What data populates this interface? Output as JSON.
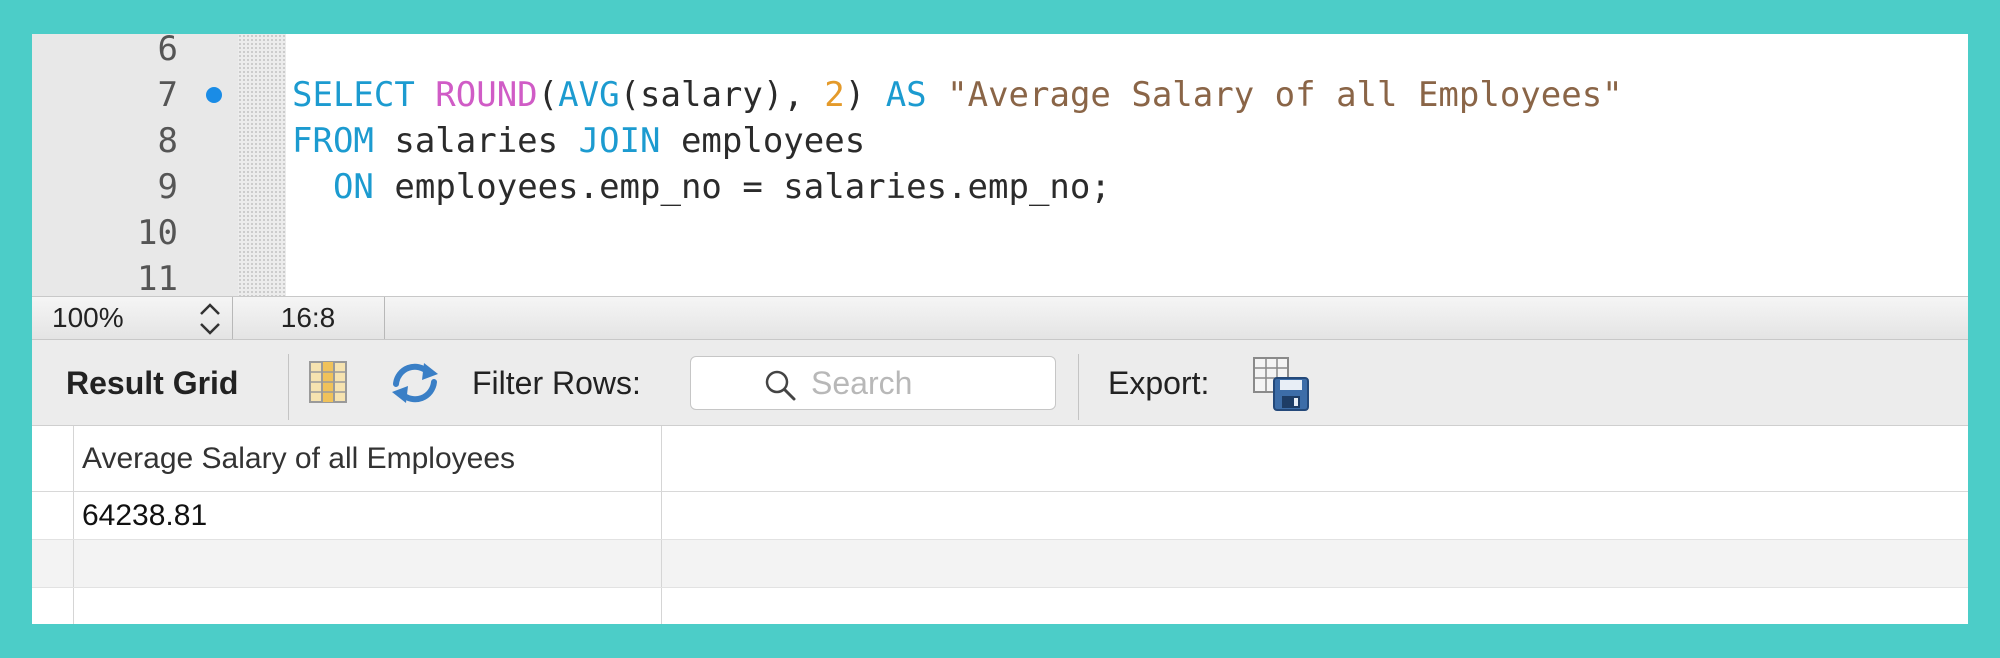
{
  "editor": {
    "lines": [
      {
        "number": "6",
        "breakpoint": false,
        "tokens": []
      },
      {
        "number": "7",
        "breakpoint": true,
        "tokens": [
          {
            "text": "SELECT ",
            "kind": "keyword"
          },
          {
            "text": "ROUND",
            "kind": "func"
          },
          {
            "text": "(",
            "kind": "plain"
          },
          {
            "text": "AVG",
            "kind": "keyword"
          },
          {
            "text": "(salary), ",
            "kind": "plain"
          },
          {
            "text": "2",
            "kind": "number"
          },
          {
            "text": ") ",
            "kind": "plain"
          },
          {
            "text": "AS",
            "kind": "keyword"
          },
          {
            "text": " ",
            "kind": "plain"
          },
          {
            "text": "\"Average Salary of all Employees\"",
            "kind": "string"
          }
        ]
      },
      {
        "number": "8",
        "breakpoint": false,
        "tokens": [
          {
            "text": "FROM",
            "kind": "keyword"
          },
          {
            "text": " salaries ",
            "kind": "plain"
          },
          {
            "text": "JOIN",
            "kind": "keyword"
          },
          {
            "text": " employees",
            "kind": "plain"
          }
        ]
      },
      {
        "number": "9",
        "breakpoint": false,
        "tokens": [
          {
            "text": "  ",
            "kind": "plain"
          },
          {
            "text": "ON",
            "kind": "keyword"
          },
          {
            "text": " employees.emp_no = salaries.emp_no;",
            "kind": "plain"
          }
        ]
      },
      {
        "number": "10",
        "breakpoint": false,
        "tokens": []
      },
      {
        "number": "11",
        "breakpoint": false,
        "tokens": []
      }
    ]
  },
  "status_bar": {
    "zoom": "100%",
    "cursor_position": "16:8"
  },
  "toolbar": {
    "result_grid_label": "Result Grid",
    "filter_label": "Filter Rows:",
    "search_placeholder": "Search",
    "search_value": "",
    "export_label": "Export:"
  },
  "result_grid": {
    "columns": [
      "Average Salary of all Employees"
    ],
    "rows": [
      [
        "64238.81"
      ]
    ]
  },
  "colors": {
    "background": "#4ccdc8",
    "keyword": "#1c9bd0",
    "function": "#d05cc6",
    "number": "#e49a2a",
    "string": "#8a6547",
    "breakpoint": "#1a8ce6"
  },
  "icons": {
    "zoom_stepper": "up-down-chevron-icon",
    "grid_toggle": "column-grid-icon",
    "refresh": "refresh-arrows-icon",
    "search": "magnifier-icon",
    "export": "export-save-icon"
  }
}
